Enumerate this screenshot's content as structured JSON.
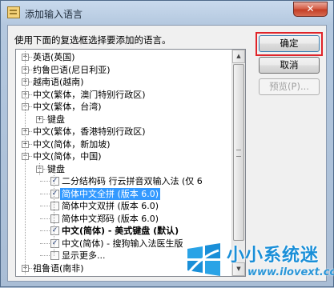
{
  "window": {
    "title": "添加输入语言",
    "close_glyph": "✕",
    "instruction": "使用下面的复选框选择要添加的语言。"
  },
  "tree": [
    {
      "id": "en",
      "label": "英语(英国)",
      "level": 0,
      "expander": "+"
    },
    {
      "id": "yo",
      "label": "约鲁巴语(尼日利亚)",
      "level": 0,
      "expander": "+"
    },
    {
      "id": "vi",
      "label": "越南语(越南)",
      "level": 0,
      "expander": "+"
    },
    {
      "id": "zh-mo",
      "label": "中文(繁体，澳门特别行政区)",
      "level": 0,
      "expander": "+"
    },
    {
      "id": "zh-tw",
      "label": "中文(繁体，台湾)",
      "level": 0,
      "expander": "−"
    },
    {
      "id": "zh-tw-kb",
      "label": "键盘",
      "level": 1,
      "expander": "+"
    },
    {
      "id": "zh-hk",
      "label": "中文(繁体，香港特别行政区)",
      "level": 0,
      "expander": "+"
    },
    {
      "id": "zh-sg",
      "label": "中文(简体，新加坡)",
      "level": 0,
      "expander": "+"
    },
    {
      "id": "zh-cn",
      "label": "中文(简体，中国)",
      "level": 0,
      "expander": "−"
    },
    {
      "id": "zh-cn-kb",
      "label": "键盘",
      "level": 1,
      "expander": "−"
    },
    {
      "id": "ime1",
      "label": "二分结构码 行云拼音双输入法 (仅 6",
      "level": 2,
      "checked": true
    },
    {
      "id": "ime2",
      "label": "简体中文全拼 (版本 6.0)",
      "level": 2,
      "checked": true,
      "selected": true
    },
    {
      "id": "ime3",
      "label": "简体中文双拼 (版本 6.0)",
      "level": 2,
      "checked": false
    },
    {
      "id": "ime4",
      "label": "简体中文郑码 (版本 6.0)",
      "level": 2,
      "checked": false
    },
    {
      "id": "ime5",
      "label": "中文(简体) - 美式键盘 (默认)",
      "level": 2,
      "checked": true,
      "bold": true
    },
    {
      "id": "ime6",
      "label": "中文(简体) - 搜狗输入法医生版",
      "level": 2,
      "checked": true
    },
    {
      "id": "more",
      "label": "显示更多...",
      "level": 2,
      "checked": false
    },
    {
      "id": "zu",
      "label": "祖鲁语(南非)",
      "level": 0,
      "expander": "+"
    }
  ],
  "buttons": {
    "ok": "确定",
    "cancel": "取消",
    "preview": "预览(P)..."
  },
  "scrollbar": {
    "up_glyph": "▲",
    "down_glyph": "▼"
  },
  "watermark": {
    "title": "小小系统迷",
    "url": "www.ilovext.com"
  },
  "colors": {
    "selection": "#3399ff",
    "highlight_box": "#e0242a",
    "watermark": "#1a8fd8"
  }
}
